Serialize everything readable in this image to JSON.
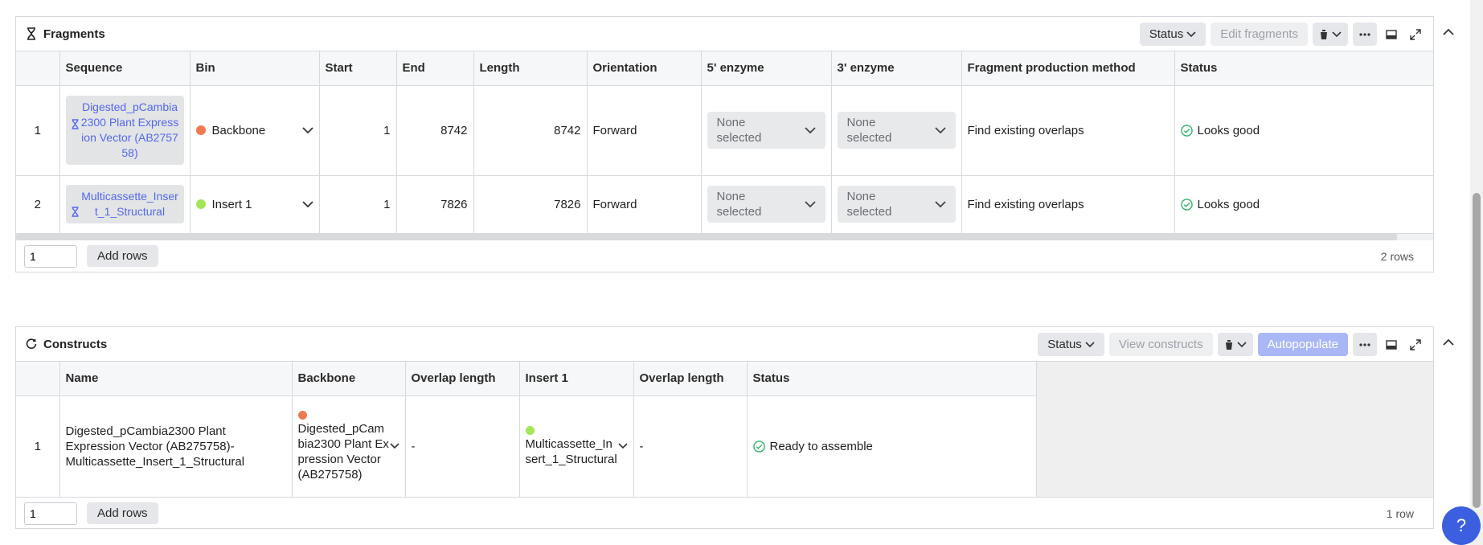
{
  "fragments": {
    "title": "Fragments",
    "toolbar": {
      "status_label": "Status",
      "edit_label": "Edit fragments"
    },
    "columns": [
      "",
      "Sequence",
      "Bin",
      "Start",
      "End",
      "Length",
      "Orientation",
      "5' enzyme",
      "3' enzyme",
      "Fragment production method",
      "Status"
    ],
    "rows": [
      {
        "index": "1",
        "sequence": "Digested_pCambia2300 Plant Expression Vector (AB275758)",
        "bin": "Backbone",
        "bin_color": "#f07a50",
        "start": "1",
        "end": "8742",
        "length": "8742",
        "orientation": "Forward",
        "enzyme5": "None selected",
        "enzyme3": "None selected",
        "method": "Find existing overlaps",
        "status": "Looks good"
      },
      {
        "index": "2",
        "sequence": "Multicassette_Insert_1_Structural",
        "bin": "Insert 1",
        "bin_color": "#a4e55a",
        "start": "1",
        "end": "7826",
        "length": "7826",
        "orientation": "Forward",
        "enzyme5": "None selected",
        "enzyme3": "None selected",
        "method": "Find existing overlaps",
        "status": "Looks good"
      }
    ],
    "footer": {
      "rows_value": "1",
      "add_rows_label": "Add rows",
      "count_label": "2 rows"
    }
  },
  "constructs": {
    "title": "Constructs",
    "toolbar": {
      "status_label": "Status",
      "view_label": "View constructs",
      "autopopulate_label": "Autopopulate"
    },
    "columns": [
      "",
      "Name",
      "Backbone",
      "Overlap length",
      "Insert 1",
      "Overlap length",
      "Status"
    ],
    "rows": [
      {
        "index": "1",
        "name": "Digested_pCambia2300 Plant Expression Vector (AB275758)-Multicassette_Insert_1_Structural",
        "backbone": "Digested_pCambia2300 Plant Expression Vector (AB275758)",
        "backbone_color": "#f07a50",
        "overlap1": "-",
        "insert": "Multicassette_Insert_1_Structural",
        "insert_color": "#a4e55a",
        "overlap2": "-",
        "status": "Ready to assemble"
      }
    ],
    "footer": {
      "rows_value": "1",
      "add_rows_label": "Add rows",
      "count_label": "1 row"
    }
  },
  "help": {
    "label": "?"
  },
  "colors": {
    "accent": "#3c5fe0",
    "link": "#5468ea",
    "success": "#2fb36e"
  }
}
